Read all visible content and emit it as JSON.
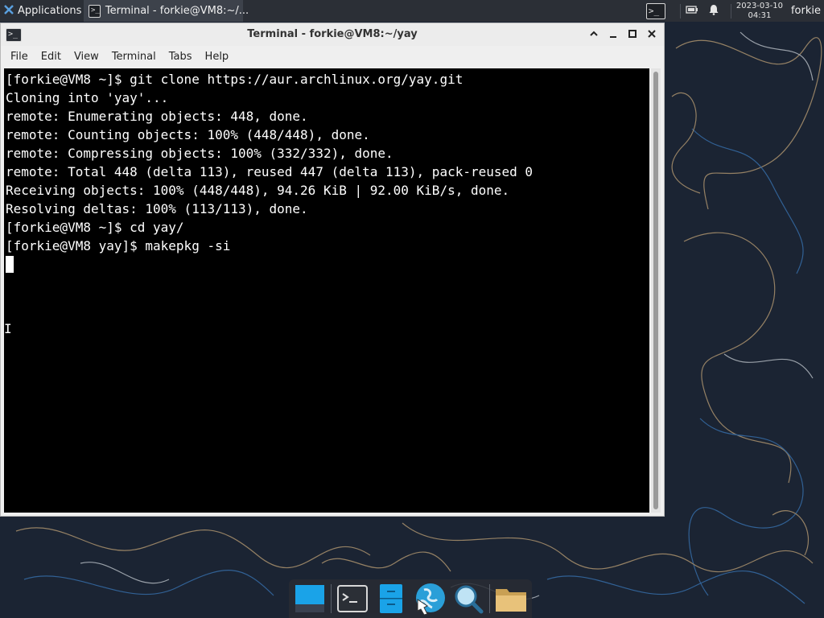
{
  "top_panel": {
    "applications_label": "Applications",
    "task_terminal_label": "Terminal - forkie@VM8:~/...",
    "clock_date": "2023-03-10",
    "clock_time": "04:31",
    "user_name": "forkie",
    "icons": {
      "applications": "xfce-mouse-icon",
      "task_terminal": "terminal-icon",
      "launcher_terminal": "terminal-icon",
      "battery": "battery-icon",
      "notifications": "bell-icon"
    }
  },
  "window": {
    "title": "Terminal - forkie@VM8:~/yay",
    "controls": {
      "up": "^",
      "minimize": "–",
      "maximize": "□",
      "close": "×"
    },
    "menu": [
      "File",
      "Edit",
      "View",
      "Terminal",
      "Tabs",
      "Help"
    ]
  },
  "terminal": {
    "lines": [
      "[forkie@VM8 ~]$ git clone https://aur.archlinux.org/yay.git",
      "Cloning into 'yay'...",
      "remote: Enumerating objects: 448, done.",
      "remote: Counting objects: 100% (448/448), done.",
      "remote: Compressing objects: 100% (332/332), done.",
      "remote: Total 448 (delta 113), reused 447 (delta 113), pack-reused 0",
      "Receiving objects: 100% (448/448), 94.26 KiB | 92.00 KiB/s, done.",
      "Resolving deltas: 100% (113/113), done.",
      "[forkie@VM8 ~]$ cd yay/",
      "[forkie@VM8 yay]$ makepkg -si"
    ],
    "background": "#000000",
    "foreground": "#ffffff"
  },
  "dock": {
    "items": [
      {
        "name": "show-desktop-icon"
      },
      {
        "name": "terminal-icon"
      },
      {
        "name": "file-manager-icon"
      },
      {
        "name": "web-browser-icon"
      },
      {
        "name": "app-finder-icon"
      },
      {
        "name": "folder-icon"
      }
    ]
  },
  "colors": {
    "wallpaper": "#1b2433",
    "panel": "#2b2f36",
    "window_bg": "#efefef"
  }
}
